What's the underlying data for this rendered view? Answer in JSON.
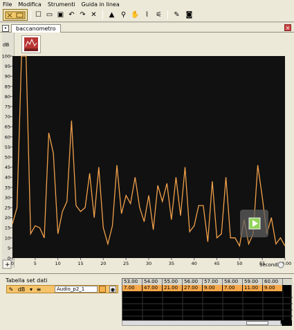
{
  "menu": [
    "File",
    "Modifica",
    "Strumenti",
    "Guida in linea"
  ],
  "toolbar": {
    "icons": [
      "logo-icon",
      "new-icon",
      "open-icon",
      "save-icon",
      "undo-icon",
      "redo-icon",
      "cut-icon",
      "pointer-icon",
      "zoom-icon",
      "hand-icon",
      "chart-icon",
      "chart2-icon",
      "edit-icon",
      "camera-icon"
    ]
  },
  "tab": {
    "label": "baccanometro"
  },
  "chart": {
    "y_unit": "dB",
    "x_label": "Secondi",
    "y_ticks": [
      "100",
      "95",
      "90",
      "85",
      "80",
      "75",
      "70",
      "65",
      "60",
      "55",
      "50",
      "45",
      "40",
      "35",
      "30",
      "25",
      "20",
      "15",
      "10",
      "5",
      "0"
    ],
    "x_ticks": [
      "0",
      "5",
      "10",
      "15",
      "20",
      "25",
      "30",
      "35",
      "40",
      "45",
      "50",
      "55",
      "60.00"
    ],
    "colors": {
      "line": "#f2a14b",
      "bg": "#111111",
      "axis": "#666666"
    }
  },
  "chart_data": {
    "type": "line",
    "x": [
      0,
      1,
      2,
      3,
      4,
      5,
      6,
      7,
      8,
      9,
      10,
      11,
      12,
      13,
      14,
      15,
      16,
      17,
      18,
      19,
      20,
      21,
      22,
      23,
      24,
      25,
      26,
      27,
      28,
      29,
      30,
      31,
      32,
      33,
      34,
      35,
      36,
      37,
      38,
      39,
      40,
      41,
      42,
      43,
      44,
      45,
      46,
      47,
      48,
      49,
      50,
      51,
      52,
      53,
      54,
      55,
      56,
      57,
      58,
      59,
      60
    ],
    "values": [
      17,
      25,
      100,
      100,
      12,
      16,
      15,
      10,
      62,
      52,
      12,
      23,
      28,
      68,
      26,
      23,
      25,
      42,
      20,
      45,
      15,
      7,
      16,
      46,
      22,
      31,
      27,
      40,
      25,
      18,
      31,
      14,
      36,
      28,
      37,
      19,
      40,
      21,
      45,
      13,
      16,
      26,
      26,
      8,
      38,
      10,
      12,
      40,
      10,
      10,
      6,
      19,
      7,
      12,
      46,
      30,
      12,
      20,
      7,
      10,
      6
    ],
    "xlabel": "Secondi",
    "ylabel": "dB",
    "xlim": [
      0,
      60
    ],
    "ylim": [
      0,
      100
    ],
    "grid": false
  },
  "dataset": {
    "title": "Tabella set dati",
    "unit": "dB",
    "series_name": "Audio_p2_1",
    "columns": [
      "53.00",
      "54.00",
      "55.00",
      "56.00",
      "57.00",
      "58.00",
      "59.00",
      "60.00"
    ],
    "values": [
      "7.00",
      "47.00",
      "21.00",
      "27.00",
      "9.00",
      "7.00",
      "11.00",
      "9.00"
    ]
  }
}
